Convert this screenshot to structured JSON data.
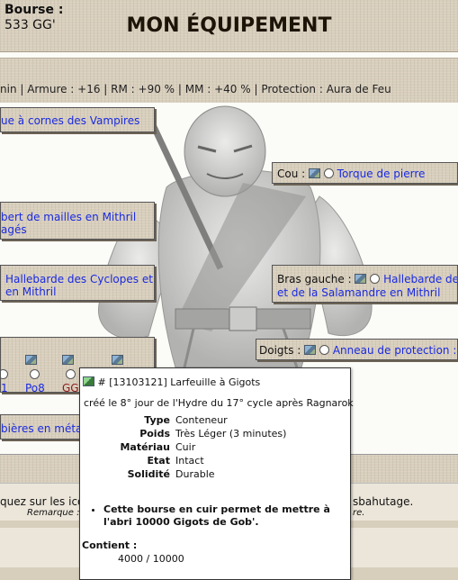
{
  "page": {
    "title": "MON ÉQUIPEMENT",
    "stats_line": "nin | Armure : +16 | RM : +90 % | MM : +40 % | Protection : Aura de Feu"
  },
  "slots": {
    "head": {
      "text": "ue à cornes des Vampires"
    },
    "bourse": {
      "label": "Bourse :",
      "value": "533 GG'"
    },
    "cou": {
      "label": "Cou :",
      "item": "Torque de pierre"
    },
    "chest": {
      "line1": "bert de mailles en Mithril",
      "line2": "agés"
    },
    "right_hand": {
      "line1": "Hallebarde des Cyclopes et",
      "line2": "en Mithril"
    },
    "left_hand": {
      "label": "Bras gauche :",
      "line1": "Hallebarde des",
      "line2": "et de la Salamandre en Mithril"
    },
    "doigts": {
      "label": "Doigts :",
      "item": "Anneau de protection : A"
    },
    "bourse_items": [
      {
        "label": "1"
      },
      {
        "label": "Po8"
      },
      {
        "label": "GG"
      }
    ],
    "belt": {
      "text": "bières en méta"
    }
  },
  "footer": {
    "text_left": "quez sur les icôn",
    "text_right": "sbahutage.",
    "remark_left": "Remarque : L",
    "remark_right": "re."
  },
  "tooltip": {
    "icon": "item-image-icon",
    "header": "# [13103121] Larfeuille à Gigots",
    "created": "créé le 8° jour de l'Hydre du 17° cycle après Ragnarok",
    "props": [
      {
        "k": "Type",
        "v": "Conteneur"
      },
      {
        "k": "Poids",
        "v": "Très Léger (3 minutes)"
      },
      {
        "k": "Matériau",
        "v": "Cuir"
      },
      {
        "k": "Etat",
        "v": "Intact"
      },
      {
        "k": "Solidité",
        "v": "Durable"
      }
    ],
    "bullet": "Cette bourse en cuir permet de mettre à l'abri 10000 Gigots de Gob'.",
    "contents_label": "Contient :",
    "contents_value": "4000 / 10000"
  },
  "colors": {
    "link": "#1a2ae0",
    "panel": "#d8cebc",
    "selected_link": "#8b1a1a"
  }
}
